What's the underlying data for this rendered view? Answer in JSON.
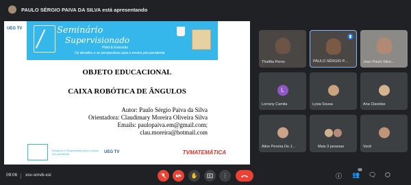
{
  "presenter": {
    "label": "PAULO SÉRGIO PAIVA DA SILVA está apresentando"
  },
  "slide": {
    "banner_title_1": "Seminário",
    "banner_title_2": "Supervisionado",
    "banner_sub_1": "Pibid & Extensão",
    "banner_sub_2": "Os desafios e as perspectivas para o ensino pós-pandemia",
    "ueg_label": "UEG",
    "ueg_tv": "TV",
    "heading_1": "OBJETO EDUCACIONAL",
    "heading_2": "CAIXA ROBÓTICA DE ÂNGULOS",
    "author": "Autor: Paulo Sérgio Paiva da Silva",
    "advisor": "Orientadora: Claudimary Moreira Oliveira Silva",
    "emails_1": "Emails: paulopaiva.em@gmail.com;",
    "emails_2": "clau.moreira@hotmail.com",
    "footer_text": "Desafios e Perspectivas para o ensino pós-pandemia",
    "footer_ueg": "UEG TV",
    "footer_brand": "TVMATEMÁTICA"
  },
  "participants": [
    {
      "name": "Thalitta Peres",
      "type": "camera"
    },
    {
      "name": "PAULO SÉRGIO P...",
      "type": "camera",
      "active": true
    },
    {
      "name": "Joao Paulo Silve...",
      "type": "camera"
    },
    {
      "name": "Lorrany Camila",
      "type": "letter",
      "letter": "L"
    },
    {
      "name": "Lyvia Sousa",
      "type": "avatar"
    },
    {
      "name": "Ana Clarelise",
      "type": "avatar"
    },
    {
      "name": "Aline Pereira De J...",
      "type": "avatar"
    },
    {
      "name": "Mais 3 pessoas",
      "type": "group"
    },
    {
      "name": "Você",
      "type": "avatar"
    }
  ],
  "bottom": {
    "time": "09:06",
    "meeting_code": "xsv-smvb-xsi",
    "people_count": "12"
  },
  "icons": {
    "mic_off": "mic-off-icon",
    "cam_off": "camera-off-icon",
    "raise_hand": "hand-icon",
    "present": "present-icon",
    "more": "more-vert-icon",
    "end": "end-call-icon",
    "info": "info-icon",
    "people": "people-icon",
    "chat": "chat-icon",
    "activities": "activities-icon"
  },
  "colors": {
    "background": "#202124",
    "tile": "#3c4043",
    "danger": "#ea4335",
    "accent": "#8ab4f8",
    "banner": "#35b7ec"
  }
}
